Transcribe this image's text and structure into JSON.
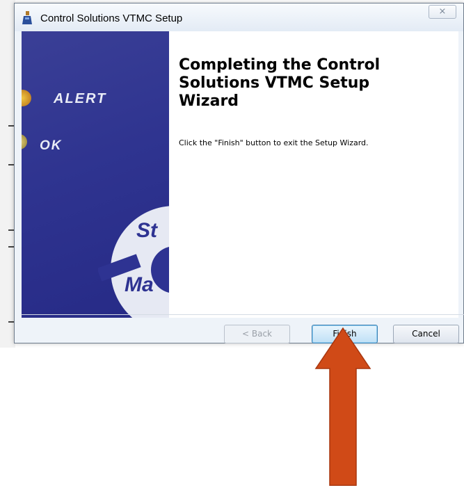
{
  "window": {
    "title": "Control Solutions VTMC Setup",
    "close_glyph": "⨯"
  },
  "side_image": {
    "labels": [
      "ALERT",
      "OK",
      "St",
      "Ma"
    ]
  },
  "main": {
    "heading": "Completing the Control Solutions VTMC Setup Wizard",
    "instruction": "Click the \"Finish\" button to exit the Setup Wizard."
  },
  "buttons": {
    "back": "< Back",
    "finish": "Finish",
    "cancel": "Cancel"
  },
  "annotation": {
    "arrow_color": "#d04a17",
    "icon": "up-arrow-icon"
  }
}
